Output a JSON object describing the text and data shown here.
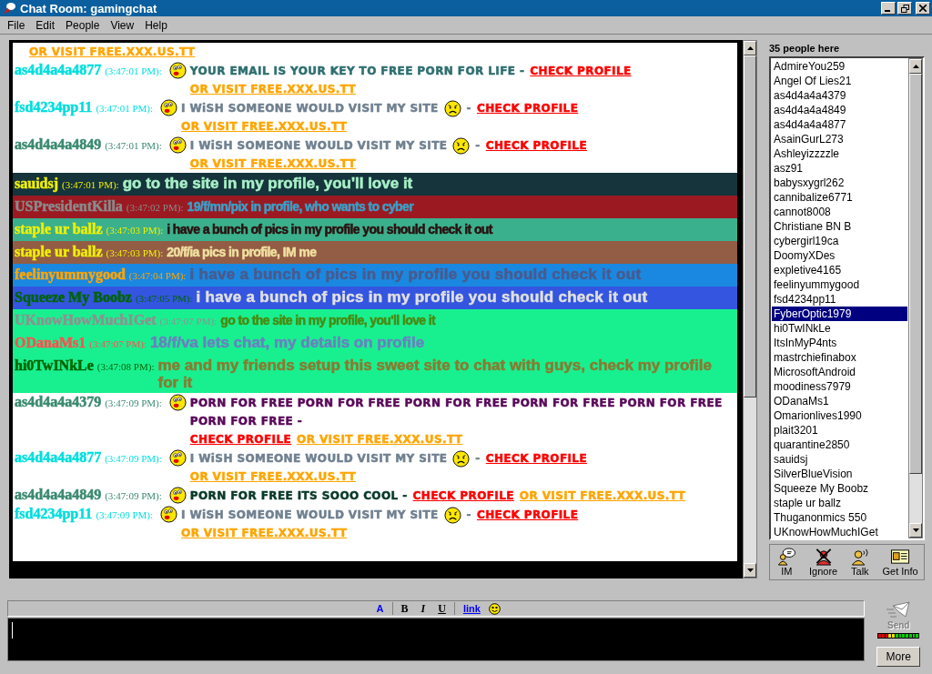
{
  "window": {
    "title": "Chat Room: gamingchat"
  },
  "menu": [
    "File",
    "Edit",
    "People",
    "View",
    "Help"
  ],
  "messages": [
    {
      "kind": "comic",
      "parts": [
        {
          "kind": "link",
          "text": "OR VISIT FREE.XXX.US.TT",
          "color": "#ffa500"
        }
      ]
    },
    {
      "kind": "comic",
      "sender": {
        "name": "as4d4a4a4877",
        "color": "#00dede"
      },
      "time": "(3:47:01 PM):",
      "parts": [
        {
          "kind": "kiss"
        },
        {
          "kind": "text",
          "text": "YOUR EMAIL IS YOUR KEY TO FREE PORN FOR LIFE - ",
          "color": "#2f6f70"
        },
        {
          "kind": "link",
          "text": "CHECK PROFILE",
          "color": "#ff0000"
        },
        {
          "kind": "link",
          "text": "OR VISIT FREE.XXX.US.TT",
          "color": "#ffa500"
        }
      ]
    },
    {
      "kind": "comic",
      "sender": {
        "name": "fsd4234pp11",
        "color": "#00dede"
      },
      "time": "(3:47:01 PM):",
      "parts": [
        {
          "kind": "kiss"
        },
        {
          "kind": "text",
          "text": "I WiSH SOMEONE WOULD VISIT MY SITE",
          "color": "#708090"
        },
        {
          "kind": "sad"
        },
        {
          "kind": "text",
          "text": " - ",
          "color": "#708090"
        },
        {
          "kind": "link",
          "text": "CHECK PROFILE",
          "color": "#ff0000"
        },
        {
          "kind": "link",
          "text": "OR VISIT FREE.XXX.US.TT",
          "color": "#ffa500"
        }
      ]
    },
    {
      "kind": "comic",
      "sender": {
        "name": "as4d4a4a4849",
        "color": "#3a8a70"
      },
      "time": "(3:47:01 PM):",
      "parts": [
        {
          "kind": "kiss"
        },
        {
          "kind": "text",
          "text": "I WiSH SOMEONE WOULD VISIT MY SITE",
          "color": "#708090"
        },
        {
          "kind": "sad"
        },
        {
          "kind": "text",
          "text": " - ",
          "color": "#708090"
        },
        {
          "kind": "link",
          "text": "CHECK PROFILE",
          "color": "#ff0000"
        },
        {
          "kind": "link",
          "text": "OR VISIT FREE.XXX.US.TT",
          "color": "#ffa500"
        }
      ]
    },
    {
      "kind": "sans",
      "color": "#15343c",
      "sender": {
        "name": "sauidsj",
        "color": "#f0f000"
      },
      "time": "(3:47:01 PM):",
      "parts": [
        {
          "kind": "text",
          "text": "go to the site in my profile, you'll love it",
          "color": "#a8f0c8"
        }
      ]
    },
    {
      "kind": "narrow",
      "color": "#9b1a22",
      "sender": {
        "name": "USPresidentKilla",
        "color": "#8a8a8a"
      },
      "time": "(3:47:02 PM):",
      "parts": [
        {
          "kind": "text",
          "text": "19/f/mn/pix in profile, who wants to cyber",
          "color": "#3aa0c8"
        }
      ]
    },
    {
      "kind": "narrow",
      "color": "#3bb08c",
      "sender": {
        "name": "staple ur ballz",
        "color": "#f0f000"
      },
      "time": "(3:47:03 PM):",
      "parts": [
        {
          "kind": "text",
          "text": "i have a bunch of pics in my profile you should check it out",
          "color": "#2a1010"
        }
      ]
    },
    {
      "kind": "narrow",
      "color": "#935c44",
      "sender": {
        "name": "staple ur ballz",
        "color": "#f0f000"
      },
      "time": "(3:47:03 PM):",
      "parts": [
        {
          "kind": "text",
          "text": "20/f/ia pics in profile, IM me",
          "color": "#f0e0a0"
        }
      ]
    },
    {
      "kind": "wide",
      "color": "#1a88e0",
      "sender": {
        "name": "feelinyummygood",
        "color": "#ffa500"
      },
      "time": "(3:47:04 PM):",
      "parts": [
        {
          "kind": "text",
          "text": "i have a bunch of pics in my profile you should check it out",
          "color": "#4a5a8c"
        }
      ]
    },
    {
      "kind": "wide",
      "color": "#3355e0",
      "sender": {
        "name": "Squeeze My Boobz",
        "color": "#006400"
      },
      "time": "(3:47:05 PM):",
      "parts": [
        {
          "kind": "text",
          "text": "i have a bunch of pics in my profile you should check it out",
          "color": "#e0e0e0"
        }
      ]
    },
    {
      "kind": "narrow",
      "color": "#18f090",
      "sender": {
        "name": "UKnowHowMuchIGet",
        "color": "#909090"
      },
      "time": "(3:47:07 PM):",
      "parts": [
        {
          "kind": "text",
          "text": "go to the site in my profile, you'll love it",
          "color": "#4a8a10"
        }
      ]
    },
    {
      "kind": "sans",
      "color": "#18f090",
      "sender": {
        "name": "ODanaMs1",
        "color": "#ff5050"
      },
      "time": "(3:47:07 PM):",
      "parts": [
        {
          "kind": "text",
          "text": "18/f/va lets chat, my details on profile",
          "color": "#6a80c0"
        }
      ]
    },
    {
      "kind": "sans",
      "color": "#18f090",
      "sender": {
        "name": "hi0TwINkLe",
        "color": "#006400"
      },
      "time": "(3:47:08 PM):",
      "parts": [
        {
          "kind": "text",
          "text": "me and my friends setup this sweet site to chat with guys, check my profile for it",
          "color": "#8a7a30"
        }
      ]
    },
    {
      "kind": "comic",
      "sender": {
        "name": "as4d4a4a4379",
        "color": "#3a8a70"
      },
      "time": "(3:47:09 PM):",
      "parts": [
        {
          "kind": "kiss"
        },
        {
          "kind": "text",
          "text": "PORN FOR FREE PORN FOR FREE PORN FOR FREE PORN FOR FREE PORN FOR FREE PORN FOR FREE - ",
          "color": "#5a0a5a"
        },
        {
          "kind": "link",
          "text": "CHECK PROFILE",
          "color": "#ff0000"
        },
        {
          "kind": "link",
          "text": "OR VISIT FREE.XXX.US.TT",
          "color": "#ffa500"
        }
      ]
    },
    {
      "kind": "comic",
      "sender": {
        "name": "as4d4a4a4877",
        "color": "#00dede"
      },
      "time": "(3:47:09 PM):",
      "parts": [
        {
          "kind": "kiss"
        },
        {
          "kind": "text",
          "text": "I WiSH SOMEONE WOULD VISIT MY SITE",
          "color": "#708090"
        },
        {
          "kind": "sad"
        },
        {
          "kind": "text",
          "text": " - ",
          "color": "#708090"
        },
        {
          "kind": "link",
          "text": "CHECK PROFILE",
          "color": "#ff0000"
        },
        {
          "kind": "link",
          "text": "OR VISIT FREE.XXX.US.TT",
          "color": "#ffa500"
        }
      ]
    },
    {
      "kind": "comic",
      "sender": {
        "name": "as4d4a4a4849",
        "color": "#3a8a70"
      },
      "time": "(3:47:09 PM):",
      "parts": [
        {
          "kind": "kiss"
        },
        {
          "kind": "text",
          "text": "PORN FOR FREE ITS SOOO COOL - ",
          "color": "#0a3a2a"
        },
        {
          "kind": "link",
          "text": "CHECK PROFILE",
          "color": "#ff0000"
        },
        {
          "kind": "link",
          "text": "OR VISIT FREE.XXX.US.TT",
          "color": "#ffa500"
        }
      ]
    },
    {
      "kind": "comic",
      "sender": {
        "name": "fsd4234pp11",
        "color": "#00dede"
      },
      "time": "(3:47:09 PM):",
      "parts": [
        {
          "kind": "kiss"
        },
        {
          "kind": "text",
          "text": "I WiSH SOMEONE WOULD VISIT MY SITE",
          "color": "#708090"
        },
        {
          "kind": "sad"
        },
        {
          "kind": "text",
          "text": " - ",
          "color": "#708090"
        },
        {
          "kind": "link",
          "text": "CHECK PROFILE",
          "color": "#ff0000"
        },
        {
          "kind": "link",
          "text": "OR VISIT FREE.XXX.US.TT",
          "color": "#ffa500"
        }
      ]
    }
  ],
  "people": {
    "count": "35 people here",
    "items": [
      {
        "name": "AdmireYou259",
        "selected": false
      },
      {
        "name": "Angel Of Lies21",
        "selected": false
      },
      {
        "name": "as4d4a4a4379",
        "selected": false
      },
      {
        "name": "as4d4a4a4849",
        "selected": false
      },
      {
        "name": "as4d4a4a4877",
        "selected": false
      },
      {
        "name": "AsainGurL273",
        "selected": false
      },
      {
        "name": "Ashleyizzzzle",
        "selected": false
      },
      {
        "name": "asz91",
        "selected": false
      },
      {
        "name": "babysxygrl262",
        "selected": false
      },
      {
        "name": "cannibalize6771",
        "selected": false
      },
      {
        "name": "cannot8008",
        "selected": false
      },
      {
        "name": "Christiane BN B",
        "selected": false
      },
      {
        "name": "cybergirl19ca",
        "selected": false
      },
      {
        "name": "DoomyXDes",
        "selected": false
      },
      {
        "name": "expletive4165",
        "selected": false
      },
      {
        "name": "feelinyummygood",
        "selected": false
      },
      {
        "name": "fsd4234pp11",
        "selected": false
      },
      {
        "name": "FyberOptic1979",
        "selected": true
      },
      {
        "name": "hi0TwINkLe",
        "selected": false
      },
      {
        "name": "ItsInMyP4nts",
        "selected": false
      },
      {
        "name": "mastrchiefinabox",
        "selected": false
      },
      {
        "name": "MicrosoftAndroid",
        "selected": false
      },
      {
        "name": "moodiness7979",
        "selected": false
      },
      {
        "name": "ODanaMs1",
        "selected": false
      },
      {
        "name": "Omarionlives1990",
        "selected": false
      },
      {
        "name": "plait3201",
        "selected": false
      },
      {
        "name": "quarantine2850",
        "selected": false
      },
      {
        "name": "sauidsj",
        "selected": false
      },
      {
        "name": "SilverBlueVision",
        "selected": false
      },
      {
        "name": "Squeeze My Boobz",
        "selected": false
      },
      {
        "name": "staple ur ballz",
        "selected": false
      },
      {
        "name": "Thuganonmics 550",
        "selected": false
      },
      {
        "name": "UKnowHowMuchIGet",
        "selected": false
      }
    ]
  },
  "actions": [
    {
      "kind": "im",
      "label": "IM"
    },
    {
      "kind": "ignore",
      "label": "Ignore"
    },
    {
      "kind": "talk",
      "label": "Talk"
    },
    {
      "kind": "info",
      "label": "Get Info"
    }
  ],
  "format_bar": [
    {
      "kind": "color",
      "text": "A"
    },
    {
      "kind": "bold",
      "text": "B"
    },
    {
      "kind": "italic",
      "text": "I"
    },
    {
      "kind": "underline",
      "text": "U"
    },
    {
      "kind": "link",
      "text": "link"
    },
    {
      "kind": "smiley"
    }
  ],
  "send": {
    "label": "Send",
    "disabled": true
  },
  "more": {
    "label": "More"
  }
}
